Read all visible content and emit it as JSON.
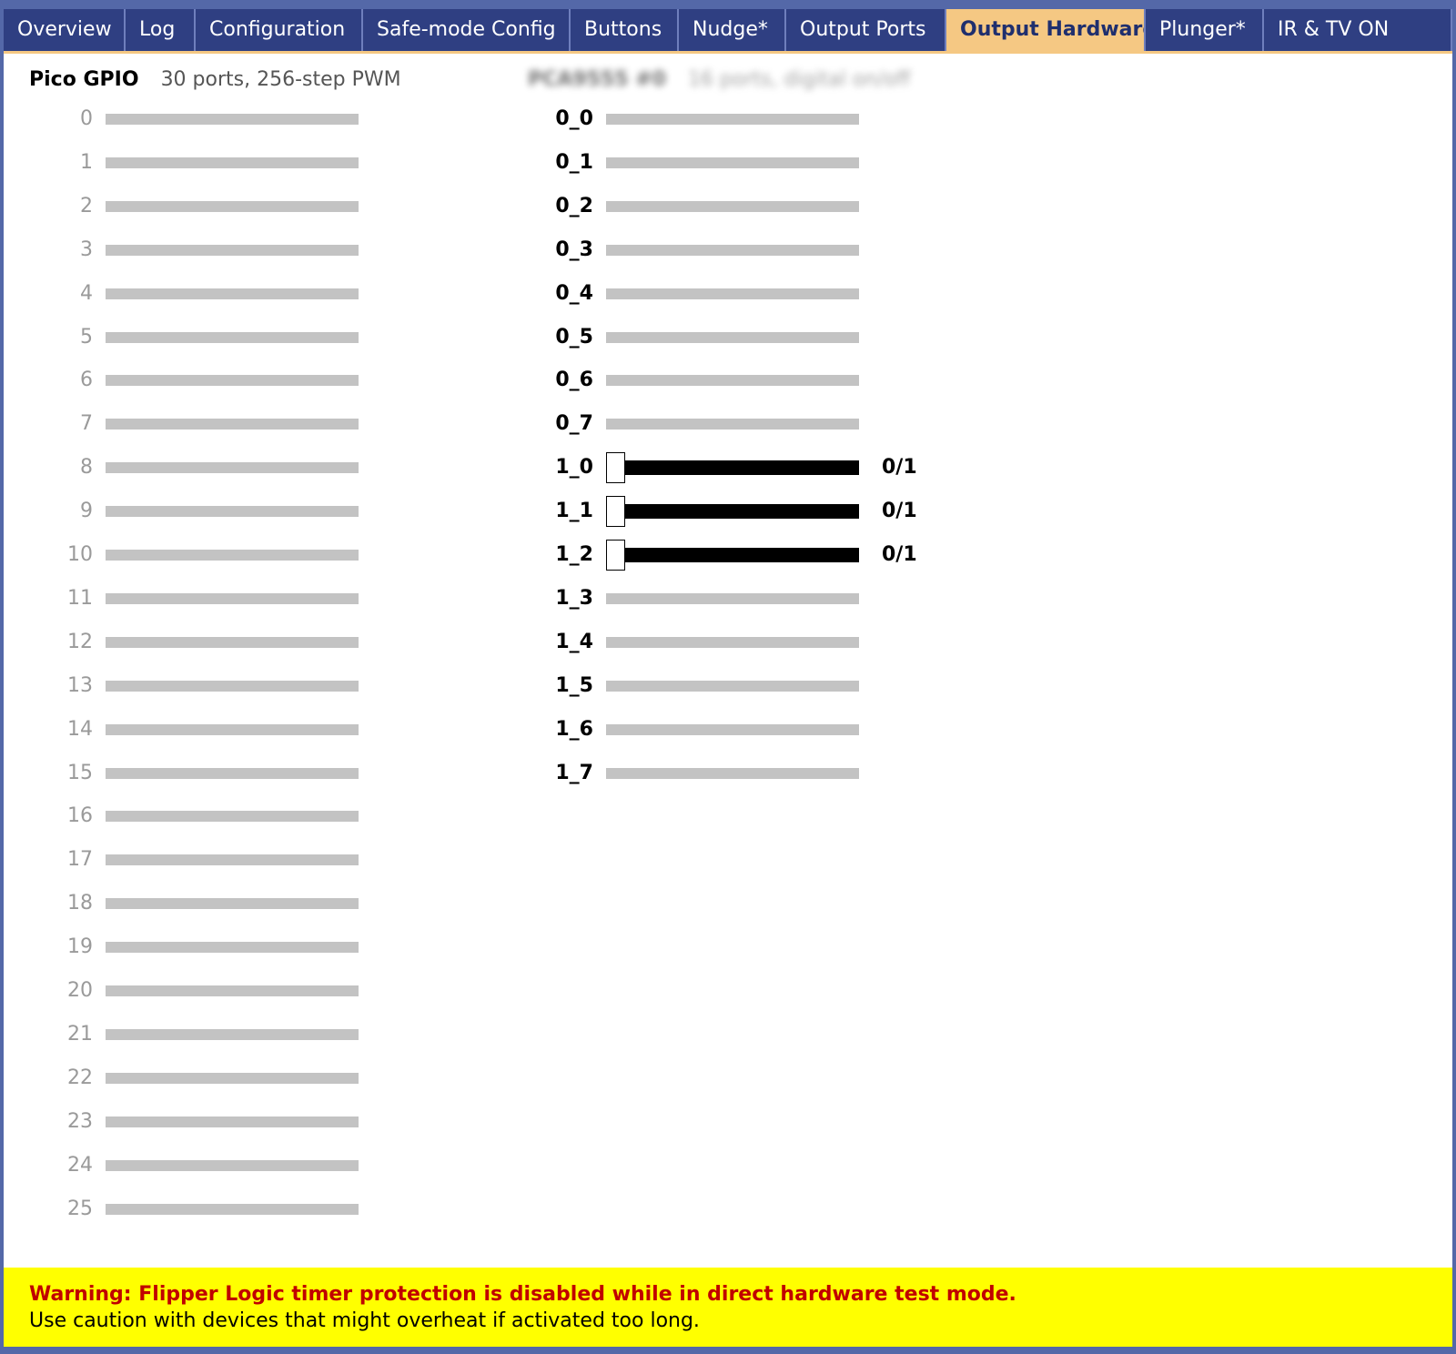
{
  "tabs": [
    {
      "label": "Overview",
      "active": false
    },
    {
      "label": "Log",
      "active": false
    },
    {
      "label": "Configuration",
      "active": false
    },
    {
      "label": "Safe-mode Config",
      "active": false
    },
    {
      "label": "Buttons",
      "active": false
    },
    {
      "label": "Nudge*",
      "active": false
    },
    {
      "label": "Output Ports",
      "active": false
    },
    {
      "label": "Output Hardware",
      "active": true
    },
    {
      "label": "Plunger*",
      "active": false
    },
    {
      "label": "IR & TV ON",
      "active": false
    }
  ],
  "gpio": {
    "name": "Pico GPIO",
    "description": "30 ports, 256-step PWM",
    "ports": [
      "0",
      "1",
      "2",
      "3",
      "4",
      "5",
      "6",
      "7",
      "8",
      "9",
      "10",
      "11",
      "12",
      "13",
      "14",
      "15",
      "16",
      "17",
      "18",
      "19",
      "20",
      "21",
      "22",
      "23",
      "24",
      "25"
    ]
  },
  "expander": {
    "name": "PCA9555 #0",
    "description": "16 ports, digital on/off",
    "ports": [
      {
        "label": "0_0",
        "active": false
      },
      {
        "label": "0_1",
        "active": false
      },
      {
        "label": "0_2",
        "active": false
      },
      {
        "label": "0_3",
        "active": false
      },
      {
        "label": "0_4",
        "active": false
      },
      {
        "label": "0_5",
        "active": false
      },
      {
        "label": "0_6",
        "active": false
      },
      {
        "label": "0_7",
        "active": false
      },
      {
        "label": "1_0",
        "active": true,
        "value": "0/1"
      },
      {
        "label": "1_1",
        "active": true,
        "value": "0/1"
      },
      {
        "label": "1_2",
        "active": true,
        "value": "0/1"
      },
      {
        "label": "1_3",
        "active": false
      },
      {
        "label": "1_4",
        "active": false
      },
      {
        "label": "1_5",
        "active": false
      },
      {
        "label": "1_6",
        "active": false
      },
      {
        "label": "1_7",
        "active": false
      }
    ]
  },
  "warning": {
    "heading": "Warning: Flipper Logic timer protection is disabled while in direct hardware test mode.",
    "body": "Use caution with devices that might overheat if activated too long."
  },
  "colors": {
    "frame": "#5468a8",
    "tab_bg": "#2f3f82",
    "tab_active": "#f5c883",
    "warning_bg": "#ffff00",
    "warning_text": "#c00000"
  }
}
